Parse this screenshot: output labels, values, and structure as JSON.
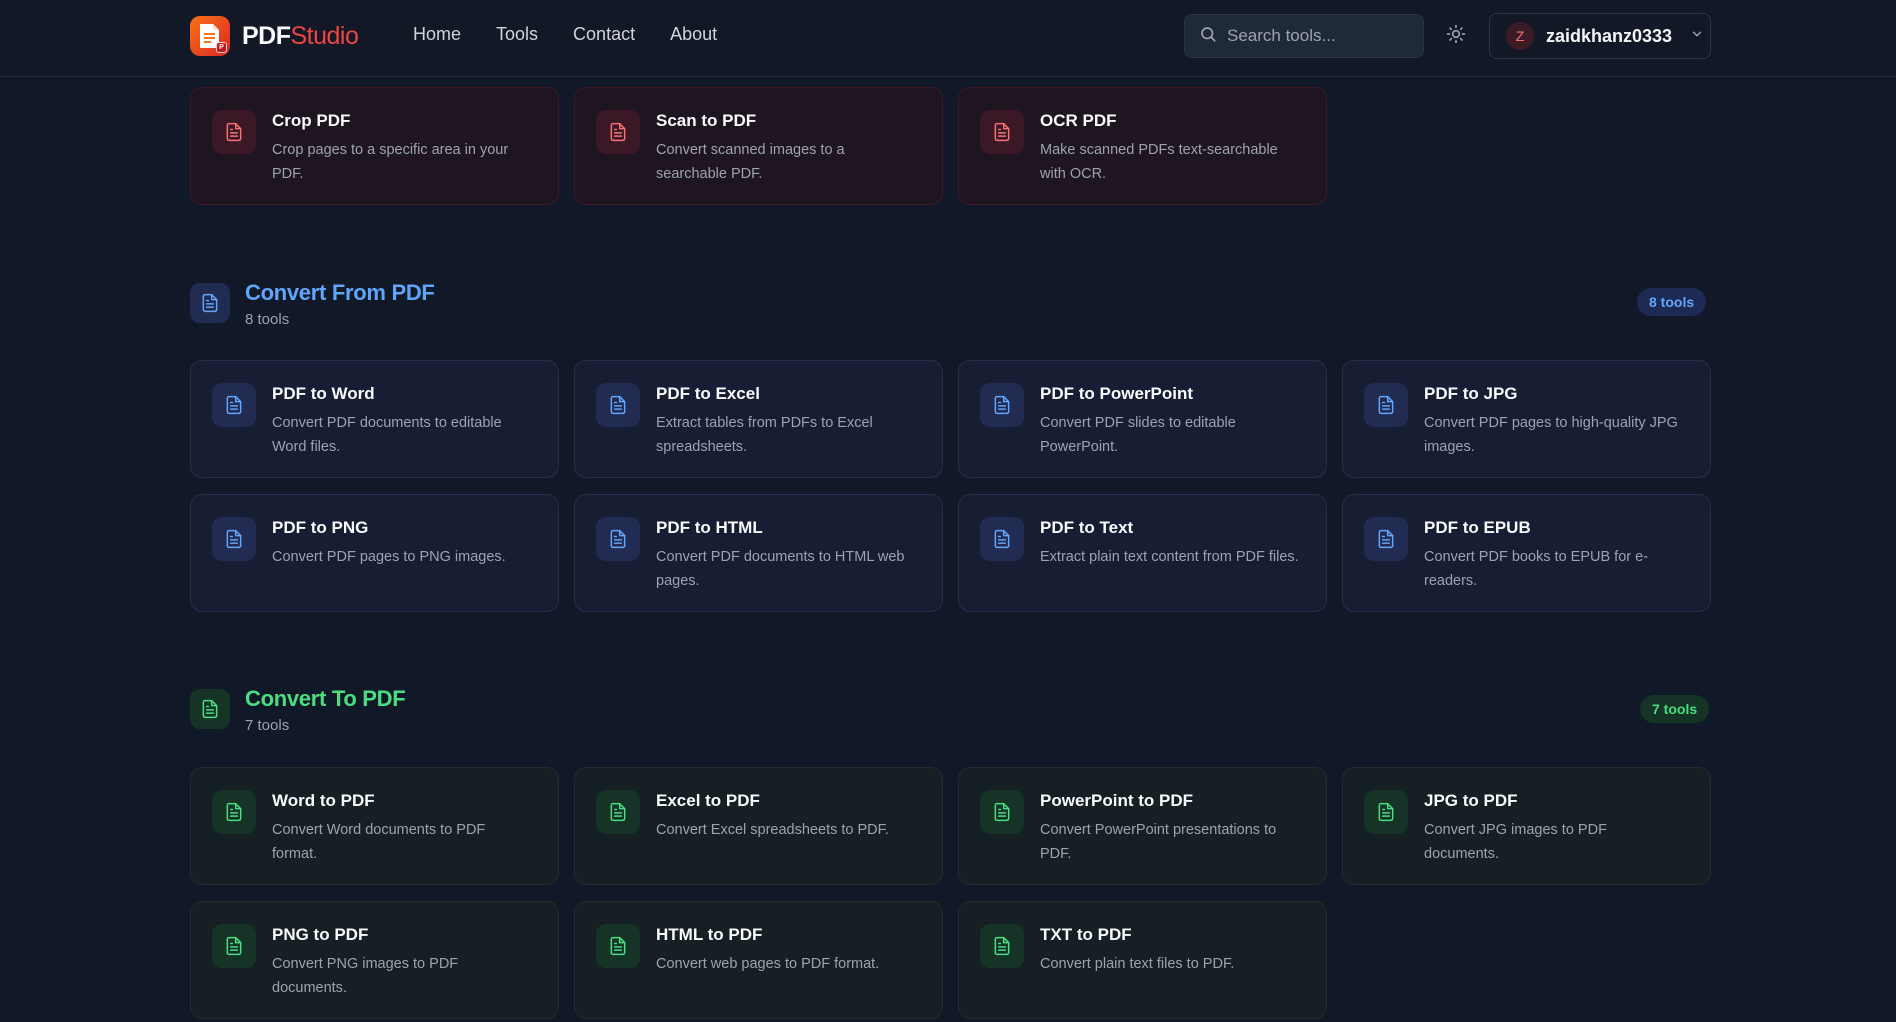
{
  "brand": {
    "name_part1": "PDF",
    "name_part2": "Studio",
    "badge": "P"
  },
  "nav": {
    "home": "Home",
    "tools": "Tools",
    "contact": "Contact",
    "about": "About"
  },
  "search": {
    "placeholder": "Search tools..."
  },
  "user": {
    "initial": "Z",
    "name": "zaidkhanz0333"
  },
  "colors": {
    "accent_red": "#ef4444",
    "accent_blue": "#60a5fa",
    "accent_green": "#4ade80",
    "background": "#111827"
  },
  "edit_section": {
    "cards": [
      {
        "title": "Crop PDF",
        "desc": "Crop pages to a specific area in your PDF."
      },
      {
        "title": "Scan to PDF",
        "desc": "Convert scanned images to a searchable PDF."
      },
      {
        "title": "OCR PDF",
        "desc": "Make scanned PDFs text-searchable with OCR."
      }
    ]
  },
  "convert_from": {
    "title": "Convert From PDF",
    "count": "8 tools",
    "badge": "8 tools",
    "cards": [
      {
        "title": "PDF to Word",
        "desc": "Convert PDF documents to editable Word files."
      },
      {
        "title": "PDF to Excel",
        "desc": "Extract tables from PDFs to Excel spreadsheets."
      },
      {
        "title": "PDF to PowerPoint",
        "desc": "Convert PDF slides to editable PowerPoint."
      },
      {
        "title": "PDF to JPG",
        "desc": "Convert PDF pages to high-quality JPG images."
      },
      {
        "title": "PDF to PNG",
        "desc": "Convert PDF pages to PNG images."
      },
      {
        "title": "PDF to HTML",
        "desc": "Convert PDF documents to HTML web pages."
      },
      {
        "title": "PDF to Text",
        "desc": "Extract plain text content from PDF files."
      },
      {
        "title": "PDF to EPUB",
        "desc": "Convert PDF books to EPUB for e-readers."
      }
    ]
  },
  "convert_to": {
    "title": "Convert To PDF",
    "count": "7 tools",
    "badge": "7 tools",
    "cards": [
      {
        "title": "Word to PDF",
        "desc": "Convert Word documents to PDF format."
      },
      {
        "title": "Excel to PDF",
        "desc": "Convert Excel spreadsheets to PDF."
      },
      {
        "title": "PowerPoint to PDF",
        "desc": "Convert PowerPoint presentations to PDF."
      },
      {
        "title": "JPG to PDF",
        "desc": "Convert JPG images to PDF documents."
      },
      {
        "title": "PNG to PDF",
        "desc": "Convert PNG images to PDF documents."
      },
      {
        "title": "HTML to PDF",
        "desc": "Convert web pages to PDF format."
      },
      {
        "title": "TXT to PDF",
        "desc": "Convert plain text files to PDF."
      }
    ]
  }
}
